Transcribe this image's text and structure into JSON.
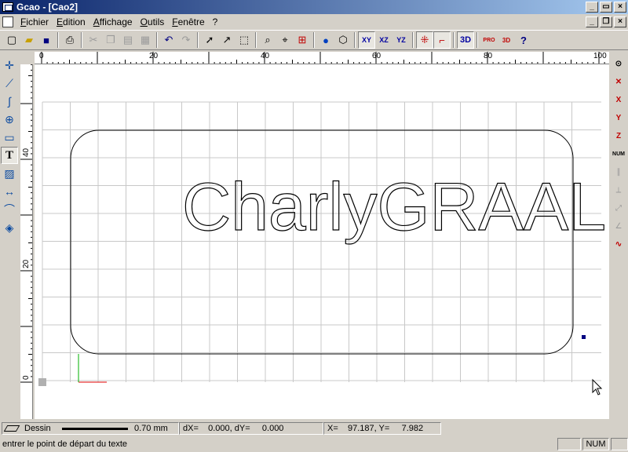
{
  "window": {
    "title": "Gcao - [Cao2]"
  },
  "menubar": {
    "items": [
      "Fichier",
      "Edition",
      "Affichage",
      "Outils",
      "Fenêtre",
      "?"
    ]
  },
  "toolbar": {
    "icons": [
      "new-icon",
      "open-icon",
      "save-icon",
      "print-icon",
      "cut-icon",
      "copy-icon",
      "paste-icon",
      "properties-icon",
      "undo-icon",
      "redo-icon",
      "select-icon",
      "select-node-icon",
      "zoom-window-icon",
      "zoom-icon",
      "zoom-move-icon",
      "zoom-all-icon",
      "render-icon",
      "box-icon",
      "plane-xy-icon",
      "plane-xz-icon",
      "plane-yz-icon",
      "snap-grid-icon",
      "snap-icon",
      "view-3d-icon",
      "machine-view-icon",
      "preview-3d-icon",
      "help-icon"
    ],
    "xy_label": "XY",
    "xz_label": "XZ",
    "yz_label": "YZ",
    "view3d_label": "3D",
    "pro_label": "PRO",
    "pro3d_label": "3D"
  },
  "left_toolbar": {
    "icons": [
      "point-icon",
      "polyline-icon",
      "curve-icon",
      "circle-icon",
      "rectangle-icon",
      "text-tool-icon",
      "hatch-icon",
      "dimension-icon",
      "offset-curve-icon",
      "fill-icon"
    ],
    "text_tool_label": "T"
  },
  "right_toolbar": {
    "labels": [
      "X",
      "Y",
      "Z",
      "NUM"
    ]
  },
  "ruler": {
    "top_labels": [
      "0",
      "20",
      "40",
      "60",
      "80",
      "100"
    ],
    "left_labels": [
      "40",
      "20",
      "0"
    ]
  },
  "drawing": {
    "text": "CharlyGRAAL",
    "colors": {
      "outline": "#000000",
      "grid": "#c8c8c8",
      "axis_x": "#e00000",
      "axis_y": "#00b000",
      "marker": "#000080"
    }
  },
  "statusbar": {
    "layer_name": "Dessin",
    "line_width": "0.70 mm",
    "delta": "dX=    0.000, dY=     0.000",
    "coords": "X=    97.187, Y=     7.982",
    "message": "entrer le point de départ du texte",
    "num_indicator": "NUM"
  }
}
